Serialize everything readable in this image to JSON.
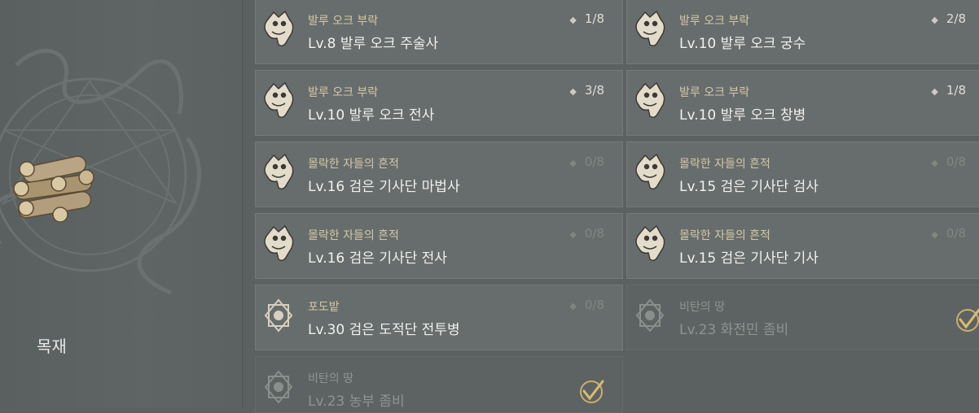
{
  "item": {
    "name": "목재"
  },
  "quests": [
    {
      "category": "발루 오크 부락",
      "title": "Lv.8 발루 오크 주술사",
      "progress": "1/8"
    },
    {
      "category": "발루 오크 부락",
      "title": "Lv.10 발루 오크 궁수",
      "progress": "2/8"
    },
    {
      "category": "발루 오크 부락",
      "title": "Lv.10 발루 오크 전사",
      "progress": "3/8"
    },
    {
      "category": "발루 오크 부락",
      "title": "Lv.10 발루 오크 창병",
      "progress": "1/8"
    },
    {
      "category": "몰락한 자들의 흔적",
      "title": "Lv.16 검은 기사단 마법사",
      "progress": "0/8"
    },
    {
      "category": "몰락한 자들의 흔적",
      "title": "Lv.15 검은 기사단 검사",
      "progress": "0/8"
    },
    {
      "category": "몰락한 자들의 흔적",
      "title": "Lv.16 검은 기사단 전사",
      "progress": "0/8"
    },
    {
      "category": "몰락한 자들의 흔적",
      "title": "Lv.15 검은 기사단 기사",
      "progress": "0/8"
    },
    {
      "category": "포도밭",
      "title": "Lv.30 검은 도적단 전투병",
      "progress": "0/8"
    },
    {
      "category": "비탄의 땅",
      "title": "Lv.23 화전민 좀비",
      "completed": true
    },
    {
      "category": "비탄의 땅",
      "title": "Lv.23 농부 좀비",
      "completed": true
    }
  ]
}
